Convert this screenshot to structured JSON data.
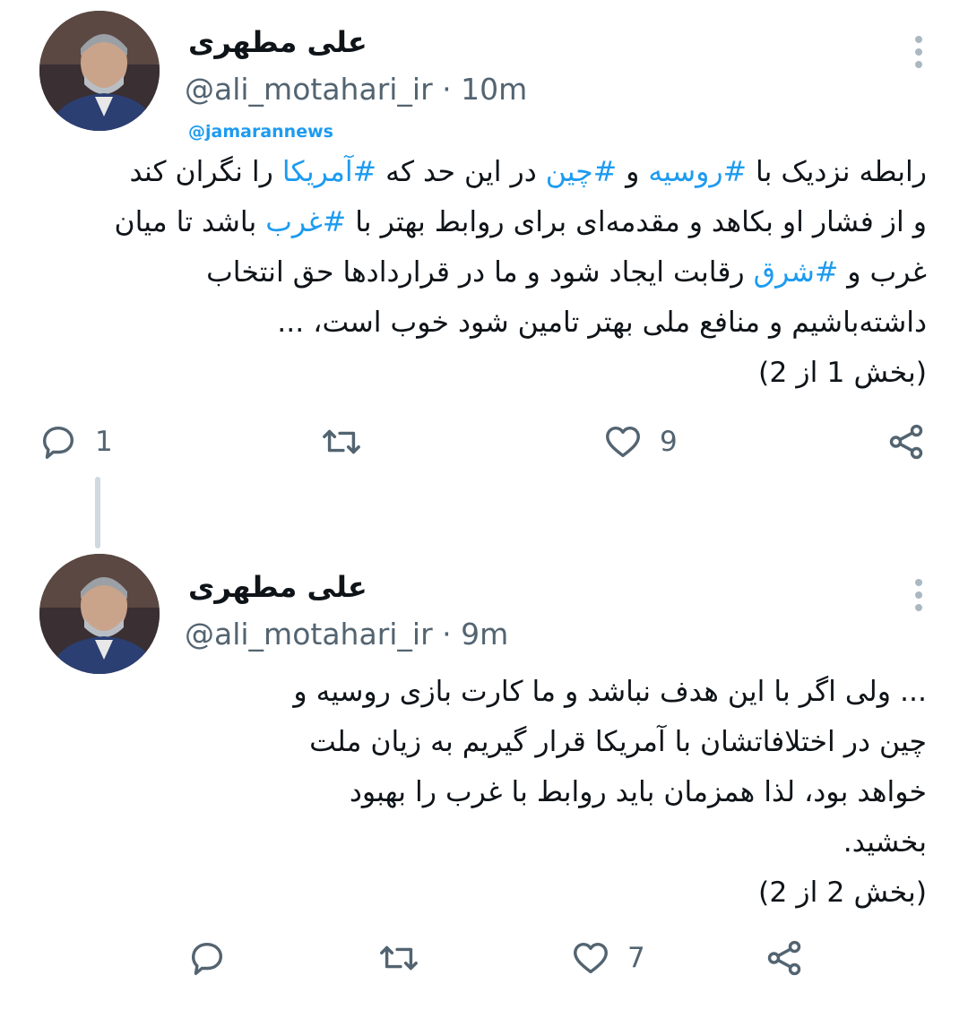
{
  "watermark": "@jamarannews",
  "tweets": [
    {
      "name": "علی مطهری",
      "handle": "@ali_motahari_ir",
      "time": "10m",
      "lines": [
        [
          "رابطه نزدیک با ",
          "#روسیه",
          " و ",
          "#چین",
          " در این حد که ",
          "#آمریکا",
          " را نگران کند"
        ],
        [
          "و از فشار او بکاهد و مقدمه‌ای برای روابط بهتر با ",
          "#غرب",
          " باشد تا میان"
        ],
        [
          "غرب و ",
          "#شرق",
          " رقابت ایجاد شود و ما در قراردادها حق انتخاب"
        ],
        [
          "داشته‌باشیم و منافع ملی بهتر تامین شود خوب است، ..."
        ],
        [
          "(بخش 1 از 2)"
        ]
      ],
      "actions": {
        "replies": "1",
        "retweets": "",
        "likes": "9"
      }
    },
    {
      "name": "علی مطهری",
      "handle": "@ali_motahari_ir",
      "time": "9m",
      "lines": [
        [
          "... ولی اگر با این هدف نباشد و ما کارت بازی روسیه و"
        ],
        [
          "چین در اختلافاتشان با آمریکا قرار گیریم به زیان ملت"
        ],
        [
          "خواهد بود، لذا همزمان باید روابط با غرب را بهبود"
        ],
        [
          "بخشید."
        ],
        [
          "(بخش 2 از 2)"
        ]
      ],
      "actions": {
        "replies": "",
        "retweets": "",
        "likes": "7"
      }
    }
  ],
  "icons": {
    "reply": "reply-icon",
    "retweet": "retweet-icon",
    "like": "heart-icon",
    "share": "share-icon",
    "more": "more-vertical-icon"
  },
  "colors": {
    "hashtag": "#1d9bf0",
    "muted": "#536471",
    "text": "#0f1419"
  }
}
